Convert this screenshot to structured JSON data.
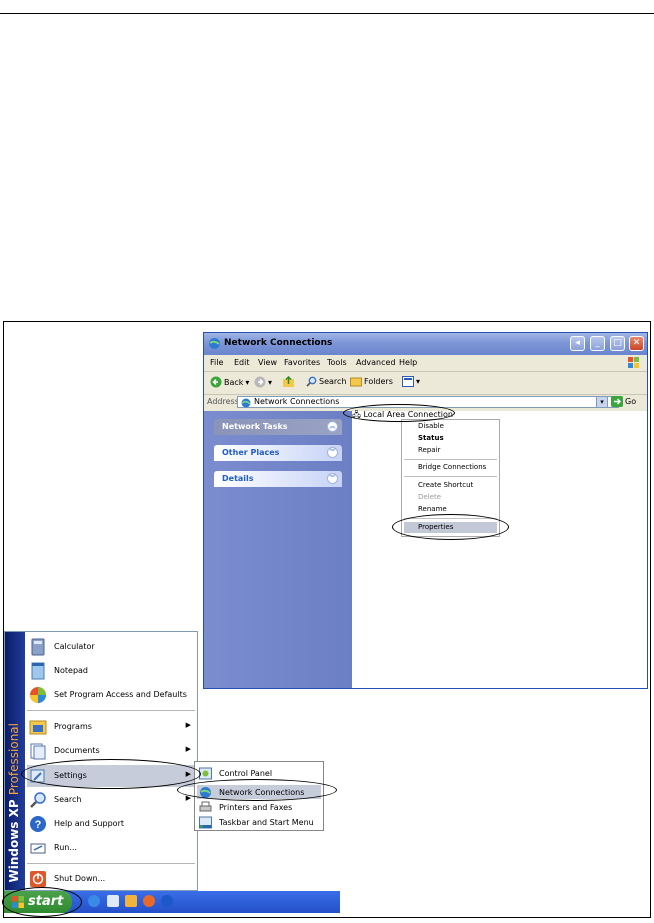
{
  "explorer": {
    "title": "Network Connections",
    "menu": [
      "File",
      "Edit",
      "View",
      "Favorites",
      "Tools",
      "Advanced",
      "Help"
    ],
    "toolbar": {
      "back": "Back",
      "search": "Search",
      "folders": "Folders"
    },
    "address": {
      "label": "Address",
      "value": "Network Connections",
      "go": "Go"
    },
    "panels": [
      "Network Tasks",
      "Other Places",
      "Details"
    ],
    "connection": "Local Area Connection",
    "context_menu": [
      "Disable",
      "Status",
      "Repair",
      "Bridge Connections",
      "Create Shortcut",
      "Delete",
      "Rename",
      "Properties"
    ]
  },
  "start_menu": {
    "sidebar_text_1": "Windows XP",
    "sidebar_text_2": "Professional",
    "pinned": [
      "Calculator",
      "Notepad",
      "Set Program Access and Defaults"
    ],
    "items": [
      "Programs",
      "Documents",
      "Settings",
      "Search",
      "Help and Support",
      "Run...",
      "Shut Down..."
    ],
    "settings_submenu": [
      "Control Panel",
      "Network Connections",
      "Printers and Faxes",
      "Taskbar and Start Menu"
    ]
  },
  "taskbar": {
    "start_label": "start"
  }
}
